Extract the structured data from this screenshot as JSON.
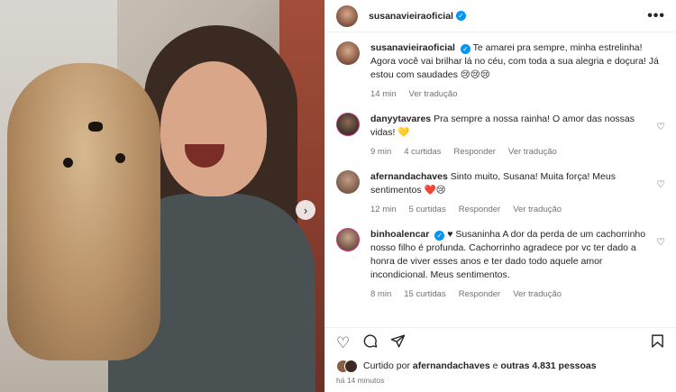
{
  "header": {
    "username": "susanavieiraoficial",
    "more_label": "•••"
  },
  "caption": {
    "username": "susanavieiraoficial",
    "text": "Te amarei pra sempre, minha estrelinha! Agora você vai brilhar lá no céu, com toda a sua alegria e doçura! Já estou com saudades 😢😢😢",
    "time": "14 min",
    "translate": "Ver tradução"
  },
  "comments": [
    {
      "username": "danyytavares",
      "text": "Pra sempre a nossa rainha! O amor das nossas vidas! 💛",
      "time": "9 min",
      "likes": "4 curtidas",
      "reply": "Responder",
      "translate": "Ver tradução"
    },
    {
      "username": "afernandachaves",
      "text": "Sinto muito, Susana! Muita força! Meus sentimentos ❤️😢",
      "time": "12 min",
      "likes": "5 curtidas",
      "reply": "Responder",
      "translate": "Ver tradução"
    },
    {
      "username": "binhoalencar",
      "text": "♥ Susaninha A dor da perda de um cachorrinho nosso filho é profunda. Cachorrinho agradece por vc ter dado a honra de viver esses anos e ter dado todo aquele amor incondicional. Meus sentimentos.",
      "time": "8 min",
      "likes": "15 curtidas",
      "reply": "Responder",
      "translate": "Ver tradução"
    }
  ],
  "likes_summary": {
    "prefix": "Curtido por",
    "user": "afernandachaves",
    "middle": "e",
    "others": "outras 4.831 pessoas"
  },
  "posted_ago": "há 14 minutos",
  "icons": {
    "heart": "heart-icon",
    "comment": "comment-icon",
    "share": "share-icon",
    "bookmark": "bookmark-icon",
    "next": "chevron-right-icon"
  },
  "colors": {
    "verified": "#0095f6",
    "muted": "#737373",
    "text": "#262626"
  }
}
